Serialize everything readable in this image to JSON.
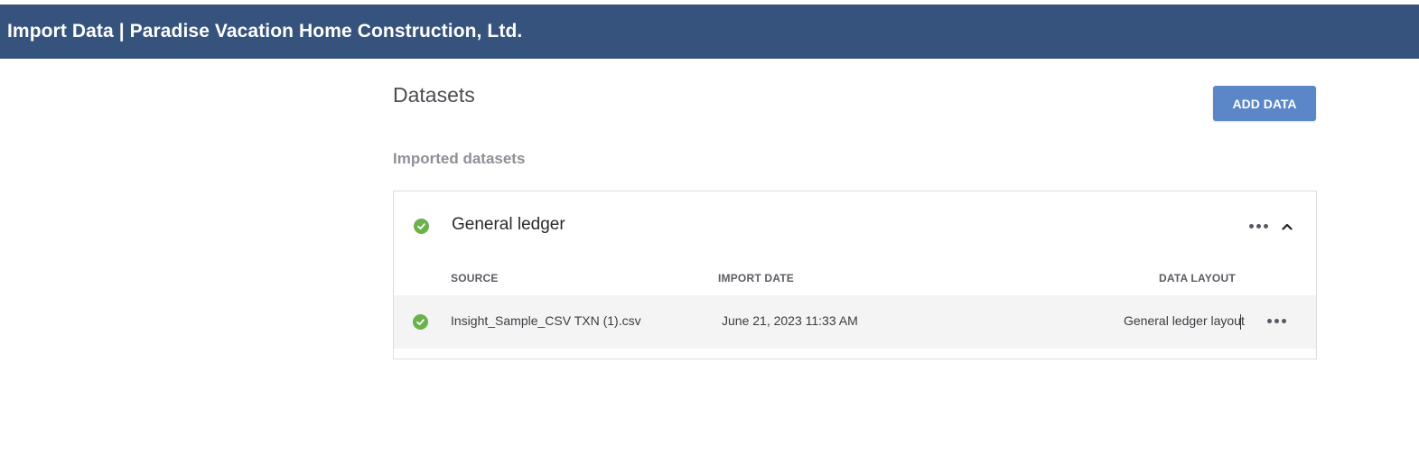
{
  "header": {
    "title": "Import Data | Paradise Vacation Home Construction, Ltd."
  },
  "main": {
    "heading": "Datasets",
    "add_button_label": "ADD DATA",
    "subheading": "Imported datasets"
  },
  "dataset": {
    "name": "General ledger",
    "status": "success",
    "columns": {
      "source": "SOURCE",
      "import_date": "IMPORT DATE",
      "data_layout": "DATA LAYOUT"
    },
    "rows": [
      {
        "source": "Insight_Sample_CSV TXN (1).csv",
        "import_date": "June 21, 2023 11:33 AM",
        "data_layout": "General ledger layout",
        "status": "success"
      }
    ]
  },
  "icons": {
    "status": "check-circle-icon",
    "menu": "more-horizontal-icon",
    "collapse": "chevron-up-icon"
  },
  "colors": {
    "header_bg": "#36537e",
    "button_bg": "#5b87c9",
    "success": "#6bb14c",
    "row_bg": "#f4f4f4"
  }
}
